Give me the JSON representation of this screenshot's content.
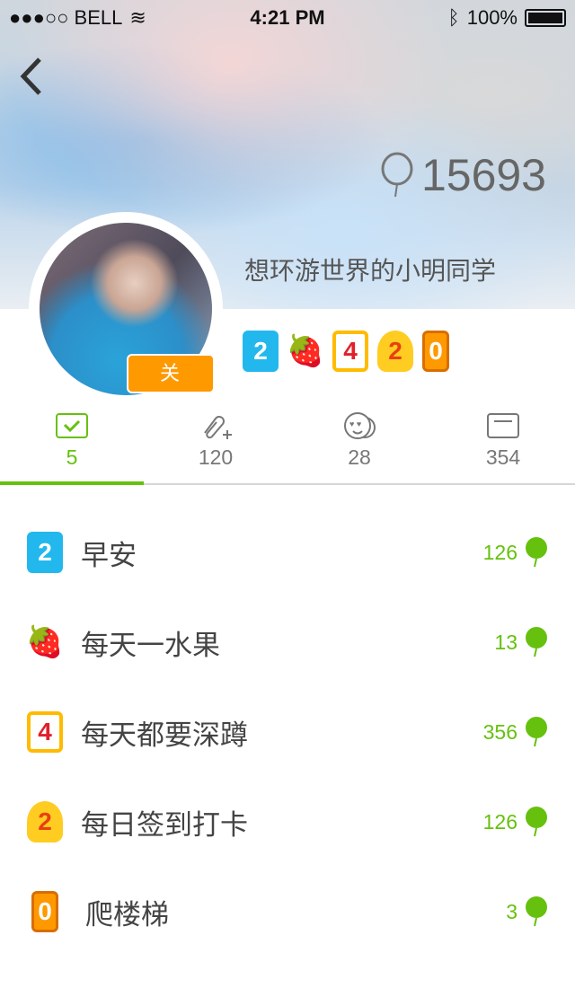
{
  "status_bar": {
    "carrier": "●●●○○ BELL",
    "time": "4:21 PM",
    "battery": "100%"
  },
  "profile": {
    "balloon_count": "15693",
    "name": "想环游世界的小明同学",
    "follow_label": "关 注",
    "badges": [
      {
        "icon": "badge-2-icon",
        "glyph": "2"
      },
      {
        "icon": "strawberry-icon",
        "glyph": "🍓"
      },
      {
        "icon": "badge-4-icon",
        "glyph": "4"
      },
      {
        "icon": "smiley-2-icon",
        "glyph": "2"
      },
      {
        "icon": "badge-0-icon",
        "glyph": "0"
      }
    ]
  },
  "tabs": [
    {
      "icon": "checkbox-icon",
      "count": "5"
    },
    {
      "icon": "paperclip-plus-icon",
      "count": "120"
    },
    {
      "icon": "heart-eyes-face-icon",
      "count": "28"
    },
    {
      "icon": "card-icon",
      "count": "354"
    }
  ],
  "habits": [
    {
      "title": "早安",
      "count": "126",
      "glyph": "2"
    },
    {
      "title": "每天一水果",
      "count": "13",
      "glyph": "🍓"
    },
    {
      "title": "每天都要深蹲",
      "count": "356",
      "glyph": "4"
    },
    {
      "title": "每日签到打卡",
      "count": "126",
      "glyph": "2"
    },
    {
      "title": "爬楼梯",
      "count": "3",
      "glyph": "0"
    }
  ],
  "colors": {
    "accent": "#66c10e",
    "follow": "#ff9900"
  }
}
